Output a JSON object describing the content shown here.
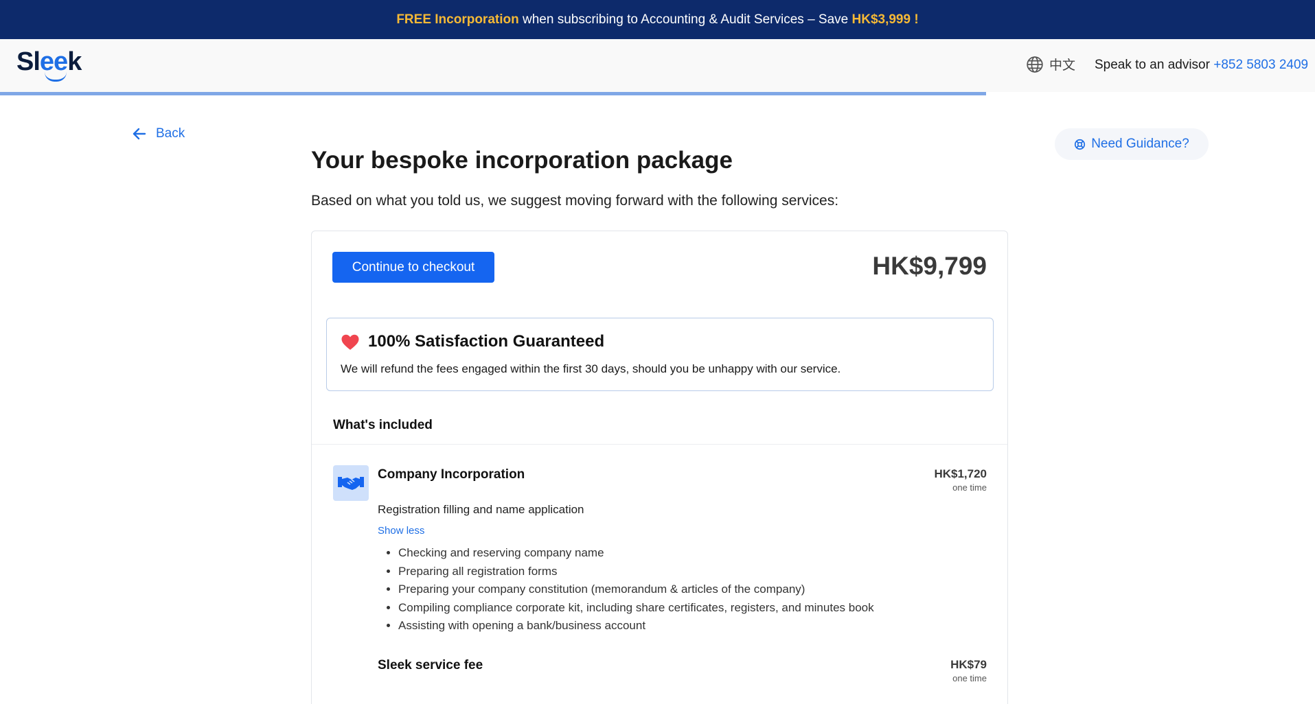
{
  "promo": {
    "part1": "FREE Incorporation",
    "part2": " when subscribing to Accounting & Audit Services – Save ",
    "part3": "HK$3,999 !"
  },
  "header": {
    "logo_prefix": "Sl",
    "logo_highlight": "ee",
    "logo_suffix": "k",
    "language": "中文",
    "advisor_text": "Speak to an advisor ",
    "advisor_phone": "+852 5803 2409"
  },
  "progress": {
    "value": 0.75
  },
  "nav": {
    "back_label": "Back",
    "guidance_label": "Need Guidance?"
  },
  "page": {
    "title": "Your bespoke incorporation package",
    "subtitle": "Based on what you told us, we suggest moving forward with the following services:"
  },
  "summary": {
    "checkout_label": "Continue to checkout",
    "total": "HK$9,799"
  },
  "guarantee": {
    "title": "100% Satisfaction Guaranteed",
    "text": "We will refund the fees engaged within the first 30 days, should you be unhappy with our service."
  },
  "included_heading": "What's included",
  "services": [
    {
      "name": "Company Incorporation",
      "price": "HK$1,720",
      "unit": "one time",
      "description": "Registration filling and name application",
      "toggle_label": "Show less",
      "items": [
        "Checking and reserving company name",
        "Preparing all registration forms",
        "Preparing your company constitution (memorandum & articles of the company)",
        "Compiling compliance corporate kit, including share certificates, registers, and minutes book",
        "Assisting with opening a bank/business account"
      ]
    },
    {
      "name": "Sleek service fee",
      "price": "HK$79",
      "unit": "one time"
    }
  ],
  "colors": {
    "promo_bg": "#0d2a6b",
    "promo_highlight": "#f5b936",
    "brand_blue": "#1f6fe5",
    "button_blue": "#1565f0",
    "heart": "#f0454f"
  },
  "icons": [
    "globe-icon",
    "arrow-left-icon",
    "lifebuoy-icon",
    "heart-icon",
    "handshake-icon"
  ]
}
